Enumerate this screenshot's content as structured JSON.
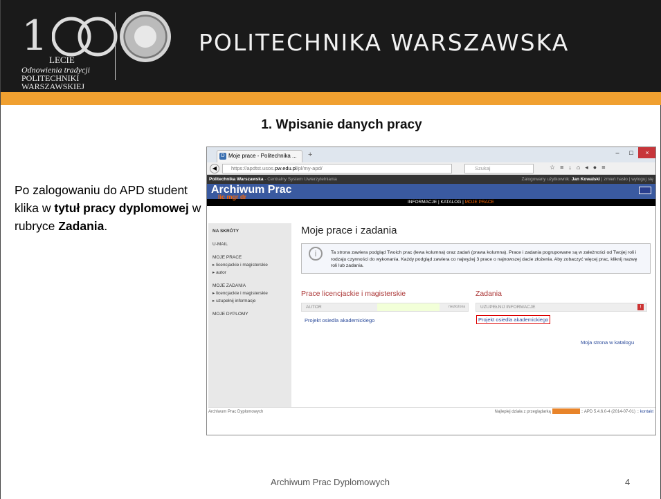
{
  "header": {
    "logo_number": "1",
    "logo_lecie": "LECIE",
    "logo_tagline": [
      "Odnowienia tradycji",
      "POLITECHNIKI",
      "WARSZAWSKIEJ"
    ],
    "university_name": "POLITECHNIKA WARSZAWSKA",
    "colors": {
      "bar": "#1a1a1a",
      "accent": "#f0a030"
    }
  },
  "slide": {
    "title": "1. Wpisanie danych pracy",
    "instruction": [
      {
        "text": "Po zalogowaniu do APD student klika w ",
        "bold": false
      },
      {
        "text": "tytuł pracy dyplomowej",
        "bold": true
      },
      {
        "text": " w rubryce ",
        "bold": false
      },
      {
        "text": "Zadania",
        "bold": true
      },
      {
        "text": ".",
        "bold": false
      }
    ],
    "footer": "Archiwum Prac Dyplomowych",
    "page_number": "4"
  },
  "browser": {
    "tab_title": "Moje prace - Politechnika ...",
    "tab_close": "×",
    "new_tab": "+",
    "url_prefix": "https://apdtst.usos.",
    "url_domain": "pw.edu.pl",
    "url_path": "/pl/my-apd/",
    "search_placeholder": "Szukaj",
    "win_min": "–",
    "win_max": "□",
    "win_close": "×"
  },
  "site": {
    "topline_left_bold": "Politechnika Warszawska",
    "topline_left_rest": " - Centralny System Uwierzytelniania",
    "topline_user_label": "Zalogowany użytkownik: ",
    "topline_user": "Jan Kowalski",
    "topline_links": " | zmień hasło | wyloguj się",
    "banner_title": "Archiwum Prac",
    "banner_sub": "lic mgr dr",
    "menu": [
      "INFORMACJE",
      "KATALOG",
      "MOJE PRACE"
    ],
    "sidebar": [
      "NA SKRÓTY",
      "U-MAIL",
      "MOJE PRACE",
      "▸ licencjackie i magisterskie",
      "▸ autor",
      "MOJE ZADANIA",
      "▸ licencjackie i magisterskie",
      "▸ uzupełnij informacje",
      "MOJE DYPLOMY"
    ],
    "page_heading": "Moje prace i zadania",
    "info_text": "Ta strona zawiera podgląd Twoich prac (lewa kolumna) oraz zadań (prawa kolumna). Prace i zadania pogrupowane są w zależności od Twojej roli i rodzaju czynności do wykonania. Każdy podgląd zawiera co najwyżej 3 prace o najnowszej dacie złożenia. Aby zobaczyć więcej prac, kliknij nazwę roli lub zadania.",
    "left_col_heading": "Prace licencjackie i magisterskie",
    "left_col_bar": "AUTOR",
    "left_col_status": "niezłożona",
    "left_col_link": "Projekt osiedla akademickiego",
    "right_col_heading": "Zadania",
    "right_col_bar": "UZUPEŁNIJ INFORMACJE",
    "right_col_link": "Projekt osiedla akademickiego",
    "catalog_link": "Moja strona w katalogu",
    "bottom_left": "Archiwum Prac Dyplomowych",
    "bottom_right": "Najlepiej działa z przeglądarką",
    "bottom_version": ":: APD 5.4.6.0-4 (2014-07-01) :: ",
    "bottom_contact": "kontakt"
  }
}
